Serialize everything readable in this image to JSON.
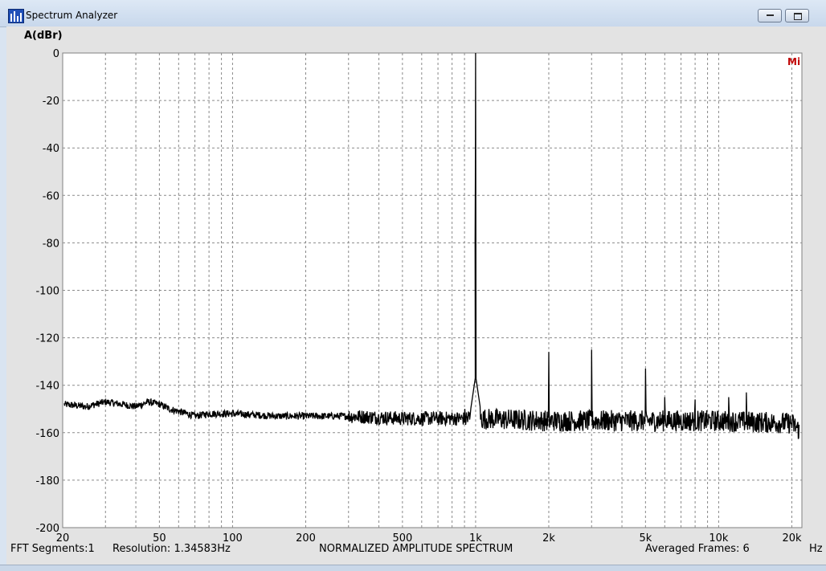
{
  "window": {
    "title": "Spectrum Analyzer",
    "icon": "spectrum-analyzer-icon",
    "controls": [
      "minimize",
      "maximize"
    ]
  },
  "chart_data": {
    "type": "line",
    "title": "NORMALIZED AMPLITUDE SPECTRUM",
    "ylabel": "A(dBr)",
    "xlabel": "Hz",
    "xscale": "log",
    "xlim": [
      20,
      22000
    ],
    "ylim": [
      -200,
      0
    ],
    "grid": true,
    "yticks": [
      0,
      -20,
      -40,
      -60,
      -80,
      -100,
      -120,
      -140,
      -160,
      -180,
      -200
    ],
    "xticks": [
      {
        "v": 20,
        "label": "20"
      },
      {
        "v": 50,
        "label": "50"
      },
      {
        "v": 100,
        "label": "100"
      },
      {
        "v": 200,
        "label": "200"
      },
      {
        "v": 500,
        "label": "500"
      },
      {
        "v": 1000,
        "label": "1k"
      },
      {
        "v": 2000,
        "label": "2k"
      },
      {
        "v": 5000,
        "label": "5k"
      },
      {
        "v": 10000,
        "label": "10k"
      },
      {
        "v": 20000,
        "label": "20k"
      }
    ],
    "series": [
      {
        "color": "#000000",
        "noise_floor": [
          [
            20,
            -148
          ],
          [
            25,
            -149
          ],
          [
            30,
            -147
          ],
          [
            35,
            -148
          ],
          [
            40,
            -149
          ],
          [
            45,
            -147
          ],
          [
            50,
            -148
          ],
          [
            55,
            -150
          ],
          [
            60,
            -151
          ],
          [
            65,
            -152
          ],
          [
            70,
            -153
          ],
          [
            80,
            -152
          ],
          [
            100,
            -152
          ],
          [
            150,
            -153
          ],
          [
            200,
            -153
          ],
          [
            300,
            -153
          ],
          [
            500,
            -154
          ],
          [
            800,
            -154
          ],
          [
            1000,
            -154
          ],
          [
            2000,
            -155
          ],
          [
            5000,
            -155
          ],
          [
            10000,
            -155
          ],
          [
            20000,
            -156
          ],
          [
            22000,
            -160
          ]
        ],
        "peaks": [
          {
            "f": 1000,
            "db": 0
          },
          {
            "f": 2000,
            "db": -126
          },
          {
            "f": 3000,
            "db": -125
          },
          {
            "f": 5000,
            "db": -133
          },
          {
            "f": 6000,
            "db": -145
          },
          {
            "f": 8000,
            "db": -146
          },
          {
            "f": 11000,
            "db": -145
          },
          {
            "f": 13000,
            "db": -143
          }
        ]
      }
    ]
  },
  "logo": "Mi",
  "footer": {
    "segments": "FFT Segments:1",
    "resolution": "Resolution: 1.34583Hz",
    "title": "NORMALIZED AMPLITUDE SPECTRUM",
    "frames": "Averaged Frames: 6",
    "unit": "Hz"
  }
}
